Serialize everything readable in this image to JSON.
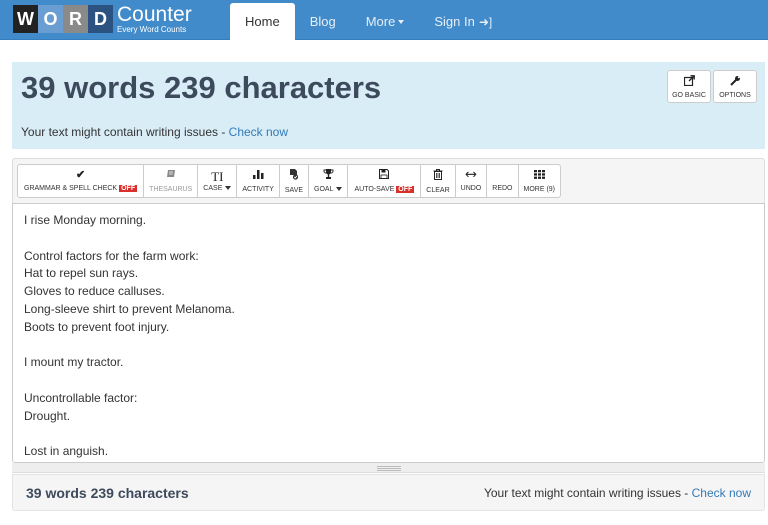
{
  "brand": {
    "logo_letters": [
      "W",
      "O",
      "R",
      "D"
    ],
    "logo_main": "Counter",
    "logo_sub": "Every Word Counts"
  },
  "nav": {
    "items": [
      {
        "label": "Home",
        "active": true
      },
      {
        "label": "Blog",
        "active": false
      },
      {
        "label": "More",
        "active": false
      },
      {
        "label": "Sign In",
        "active": false
      }
    ]
  },
  "header": {
    "count_text": "39 words 239 characters",
    "issues_text": "Your text might contain writing issues - ",
    "issues_link": "Check now",
    "buttons": [
      {
        "label": "GO BASIC",
        "icon": "external-link-icon"
      },
      {
        "label": "OPTIONS",
        "icon": "wrench-icon"
      }
    ]
  },
  "toolbar": {
    "buttons": [
      {
        "label": "GRAMMAR & SPELL CHECK",
        "icon": "checkmark-icon",
        "badge": "OFF"
      },
      {
        "label": "THESAURUS",
        "icon": "book-icon",
        "disabled": true
      },
      {
        "label": "CASE",
        "icon": "text-case-icon",
        "dropdown": true
      },
      {
        "label": "ACTIVITY",
        "icon": "bar-chart-icon"
      },
      {
        "label": "SAVE",
        "icon": "save-file-icon"
      },
      {
        "label": "GOAL",
        "icon": "trophy-icon",
        "dropdown": true
      },
      {
        "label": "AUTO-SAVE",
        "icon": "floppy-icon",
        "badge": "OFF"
      },
      {
        "label": "CLEAR",
        "icon": "trash-icon"
      },
      {
        "label": "UNDO",
        "icon": "arrow-left-icon"
      },
      {
        "label": "REDO",
        "icon": "arrow-right-icon"
      },
      {
        "label": "MORE (9)",
        "icon": "grid-icon"
      }
    ]
  },
  "editor": {
    "text": "I rise Monday morning.\n\nControl factors for the farm work:\nHat to repel sun rays.\nGloves to reduce calluses.\nLong-sleeve shirt to prevent Melanoma.\nBoots to prevent foot injury.\n\nI mount my tractor.\n\nUncontrollable factor:\nDrought.\n\nLost in anguish."
  },
  "footer": {
    "count_text": "39 words 239 characters",
    "issues_text": "Your text might contain writing issues - ",
    "issues_link": "Check now"
  },
  "colors": {
    "navbar": "#428bca",
    "header_bg": "#d9edf7",
    "link": "#337ab7",
    "off_badge": "#d9302c"
  }
}
